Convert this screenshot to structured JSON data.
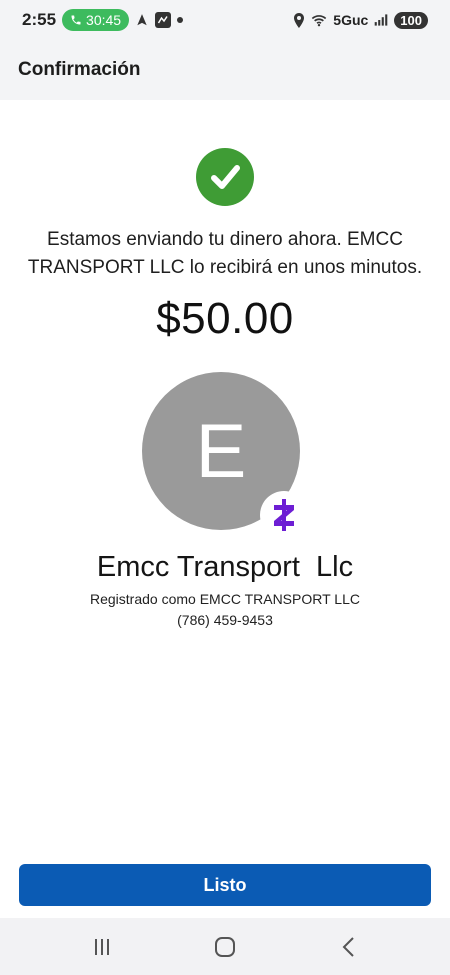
{
  "status_bar": {
    "time": "2:55",
    "call_duration": "30:45",
    "network": "5Guc",
    "battery": "100",
    "icons": [
      "phone-icon",
      "navigation-icon",
      "app-icon",
      "dot-icon",
      "location-icon",
      "wifi-icon",
      "signal-icon"
    ]
  },
  "header": {
    "title": "Confirmación"
  },
  "confirmation": {
    "message": "Estamos enviando tu dinero ahora. EMCC TRANSPORT LLC lo recibirá en unos minutos.",
    "amount": "$50.00"
  },
  "recipient": {
    "avatar_initial": "E",
    "name": "Emcc Transport  Llc",
    "registered_as": "Registrado como EMCC TRANSPORT LLC",
    "phone": "(786) 459-9453"
  },
  "actions": {
    "done_label": "Listo"
  },
  "colors": {
    "success_green": "#3f9c35",
    "primary_blue": "#0b5bb4",
    "zelle_purple": "#6d1ed4",
    "avatar_gray": "#9a9a9a"
  }
}
